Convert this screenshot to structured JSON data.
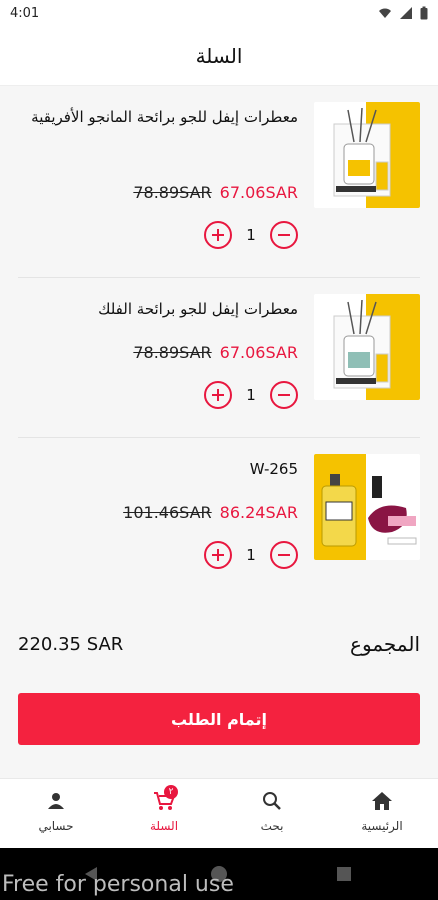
{
  "status_bar": {
    "time": "4:01"
  },
  "header": {
    "title": "السلة"
  },
  "cart": {
    "items": [
      {
        "name": "معطرات إيفل للجو برائحة المانجو الأفريقية",
        "price_new": "67.06SAR",
        "price_old": "78.89SAR",
        "quantity": "1",
        "accent": "#f5c200"
      },
      {
        "name": "معطرات إيفل للجو برائحة الفلك",
        "price_new": "67.06SAR",
        "price_old": "78.89SAR",
        "quantity": "1",
        "accent": "#f5c200"
      },
      {
        "name": "W-265",
        "price_new": "86.24SAR",
        "price_old": "101.46SAR",
        "quantity": "1",
        "accent": "#f5c200"
      }
    ]
  },
  "total": {
    "label": "المجموع",
    "value": "220.35 SAR"
  },
  "checkout": {
    "label": "إتمام الطلب"
  },
  "bottom_nav": {
    "items": [
      {
        "label": "حسابي",
        "icon": "person-icon"
      },
      {
        "label": "السلة",
        "icon": "cart-icon",
        "badge": "٢",
        "active": true
      },
      {
        "label": "بحث",
        "icon": "search-icon"
      },
      {
        "label": "الرئيسية",
        "icon": "home-icon"
      }
    ]
  },
  "watermark": "Free for personal use",
  "colors": {
    "accent": "#e8173f",
    "button": "#f4223f"
  }
}
